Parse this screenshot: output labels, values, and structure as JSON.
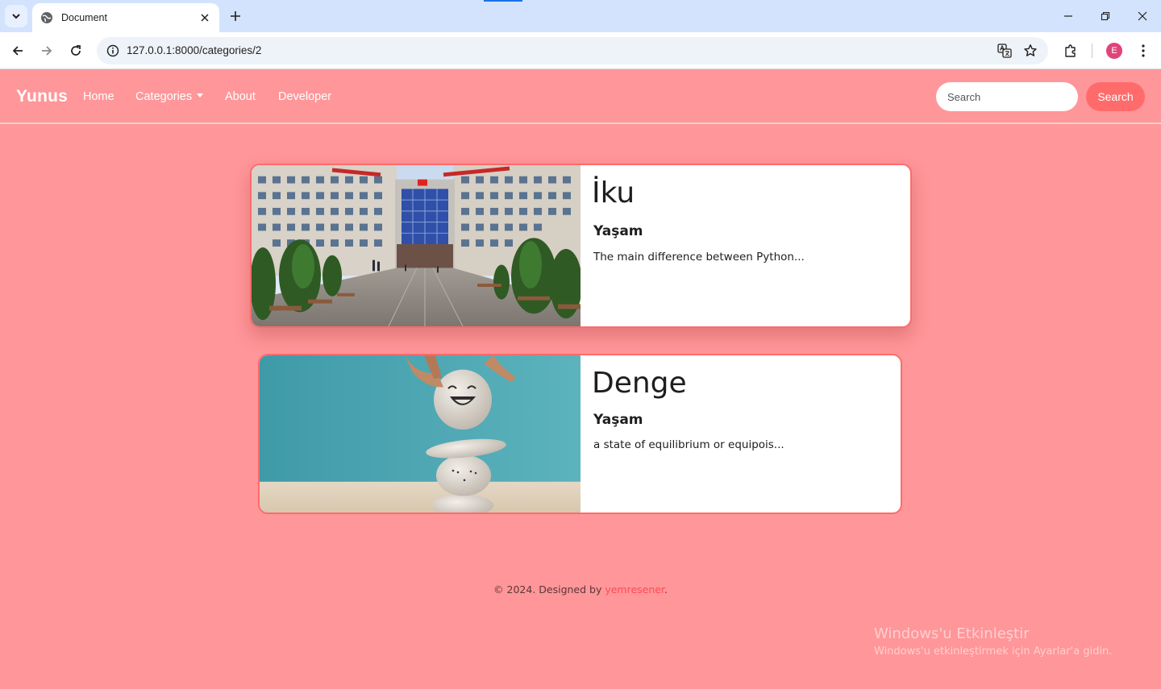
{
  "browser": {
    "tab_title": "Document",
    "url": "127.0.0.1:8000/categories/2",
    "profile_initial": "E",
    "profile_color": "#e0447a"
  },
  "navbar": {
    "brand": "Yunus",
    "links": [
      "Home",
      "Categories",
      "About",
      "Developer"
    ],
    "search_placeholder": "Search",
    "search_button": "Search",
    "background": "#ff9699",
    "accent": "#ff6b6b"
  },
  "cards": [
    {
      "title": "İku",
      "category": "Yaşam",
      "excerpt": "The main difference between Python..."
    },
    {
      "title": "Denge",
      "category": "Yaşam",
      "excerpt": "a state of equilibrium or equipois..."
    }
  ],
  "footer": {
    "prefix": "© 2024. Designed by",
    "designer": "yemresener",
    "suffix": "."
  },
  "watermark": {
    "line1": "Windows'u Etkinleştir",
    "line2": "Windows'u etkinleştirmek için Ayarlar'a gidin."
  },
  "icons": {
    "tab_search": "chevron-down-icon",
    "favicon": "globe-icon",
    "tab_close": "close-icon",
    "new_tab": "plus-icon",
    "back": "arrow-left-icon",
    "forward": "arrow-right-icon",
    "reload": "reload-icon",
    "site_info": "info-icon",
    "translate": "translate-icon",
    "bookmark": "star-icon",
    "extensions": "puzzle-icon",
    "menu": "kebab-menu-icon"
  }
}
